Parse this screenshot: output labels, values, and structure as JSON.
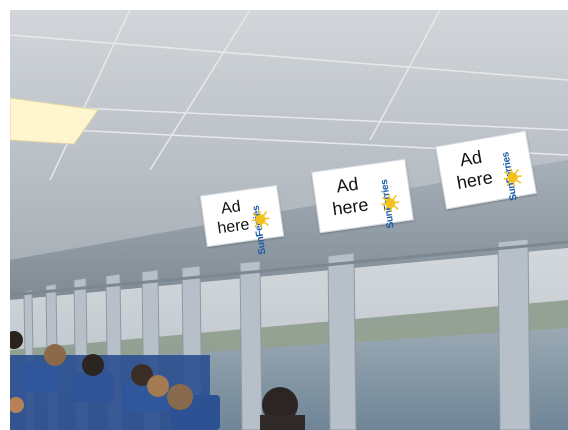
{
  "ads": [
    {
      "text": "Ad\nhere",
      "brand": "SunFerries"
    },
    {
      "text": "Ad\nhere",
      "brand": "SunFerries"
    },
    {
      "text": "Ad\nhere",
      "brand": "SunFerries"
    }
  ],
  "colors": {
    "ceiling": "#c9ced3",
    "wall": "#9aa6b1",
    "window_frame": "#b9c2ca",
    "water": "#7f93a3",
    "sky": "#c6ced6",
    "brand_blue": "#1d5aa8",
    "sun_yellow": "#f2c21b",
    "seat_blue": "#2b4f8f"
  }
}
